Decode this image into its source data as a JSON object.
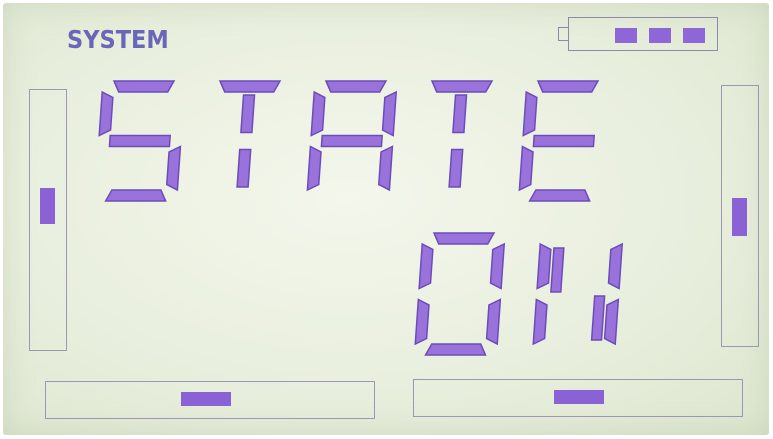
{
  "header": {
    "label": "SYSTEM"
  },
  "display": {
    "line1": "STATE",
    "line2": "ON"
  },
  "battery": {
    "level_bars": 3,
    "max_bars": 4
  },
  "indicators": {
    "left_vertical_level": 0.55,
    "right_vertical_level": 0.5,
    "bottom_left_level": 0.5,
    "bottom_right_level": 0.5
  },
  "colors": {
    "segment": "#9a72dc",
    "lcd_background": "#e9efde",
    "frame": "#9a98b2"
  }
}
